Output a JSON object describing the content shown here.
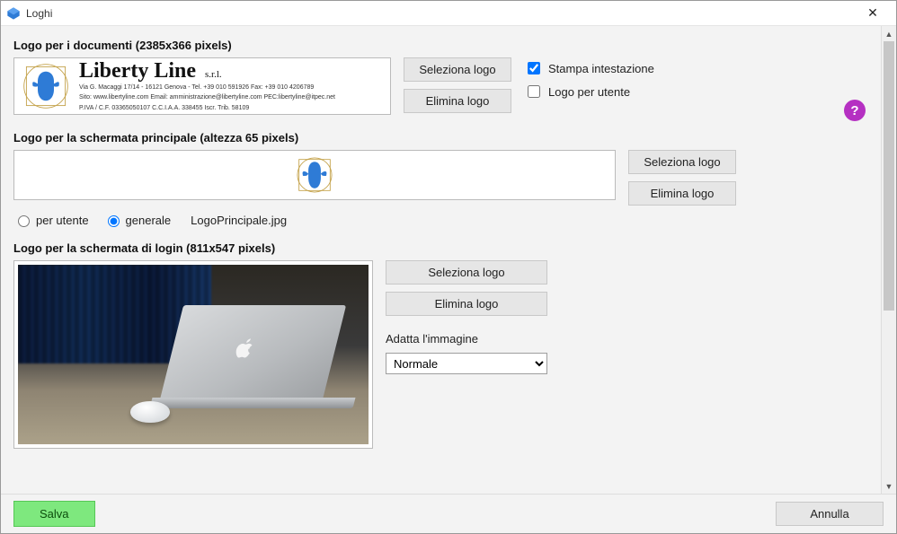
{
  "window": {
    "title": "Loghi"
  },
  "section1": {
    "title": "Logo per i documenti (2385x366 pixels)",
    "logo": {
      "company": "Liberty Line",
      "suffix": "s.r.l.",
      "line1": "Via G. Macaggi 17/14 - 16121 Genova - Tel. +39 010 591926  Fax: +39 010 4206789",
      "line2": "Sito: www.libertyline.com Email: amministrazione@libertyline.com PEC:libertyline@itpec.net",
      "line3": "P.IVA / C.F. 03365050107  C.C.I.A.A. 338455  Iscr. Trib. 58109"
    },
    "select_btn": "Seleziona logo",
    "delete_btn": "Elimina logo",
    "check1": "Stampa intestazione",
    "check1_checked": true,
    "check2": "Logo per utente",
    "check2_checked": false
  },
  "section2": {
    "title": "Logo per la schermata principale (altezza 65 pixels)",
    "select_btn": "Seleziona logo",
    "delete_btn": "Elimina logo",
    "radio_user": "per utente",
    "radio_general": "generale",
    "radio_selected": "generale",
    "filename": "LogoPrincipale.jpg"
  },
  "section3": {
    "title": "Logo per la schermata di login (811x547 pixels)",
    "select_btn": "Seleziona logo",
    "delete_btn": "Elimina logo",
    "fit_label": "Adatta l'immagine",
    "fit_options": [
      "Normale"
    ],
    "fit_selected": "Normale"
  },
  "footer": {
    "save": "Salva",
    "cancel": "Annulla"
  },
  "help_tooltip": "?"
}
